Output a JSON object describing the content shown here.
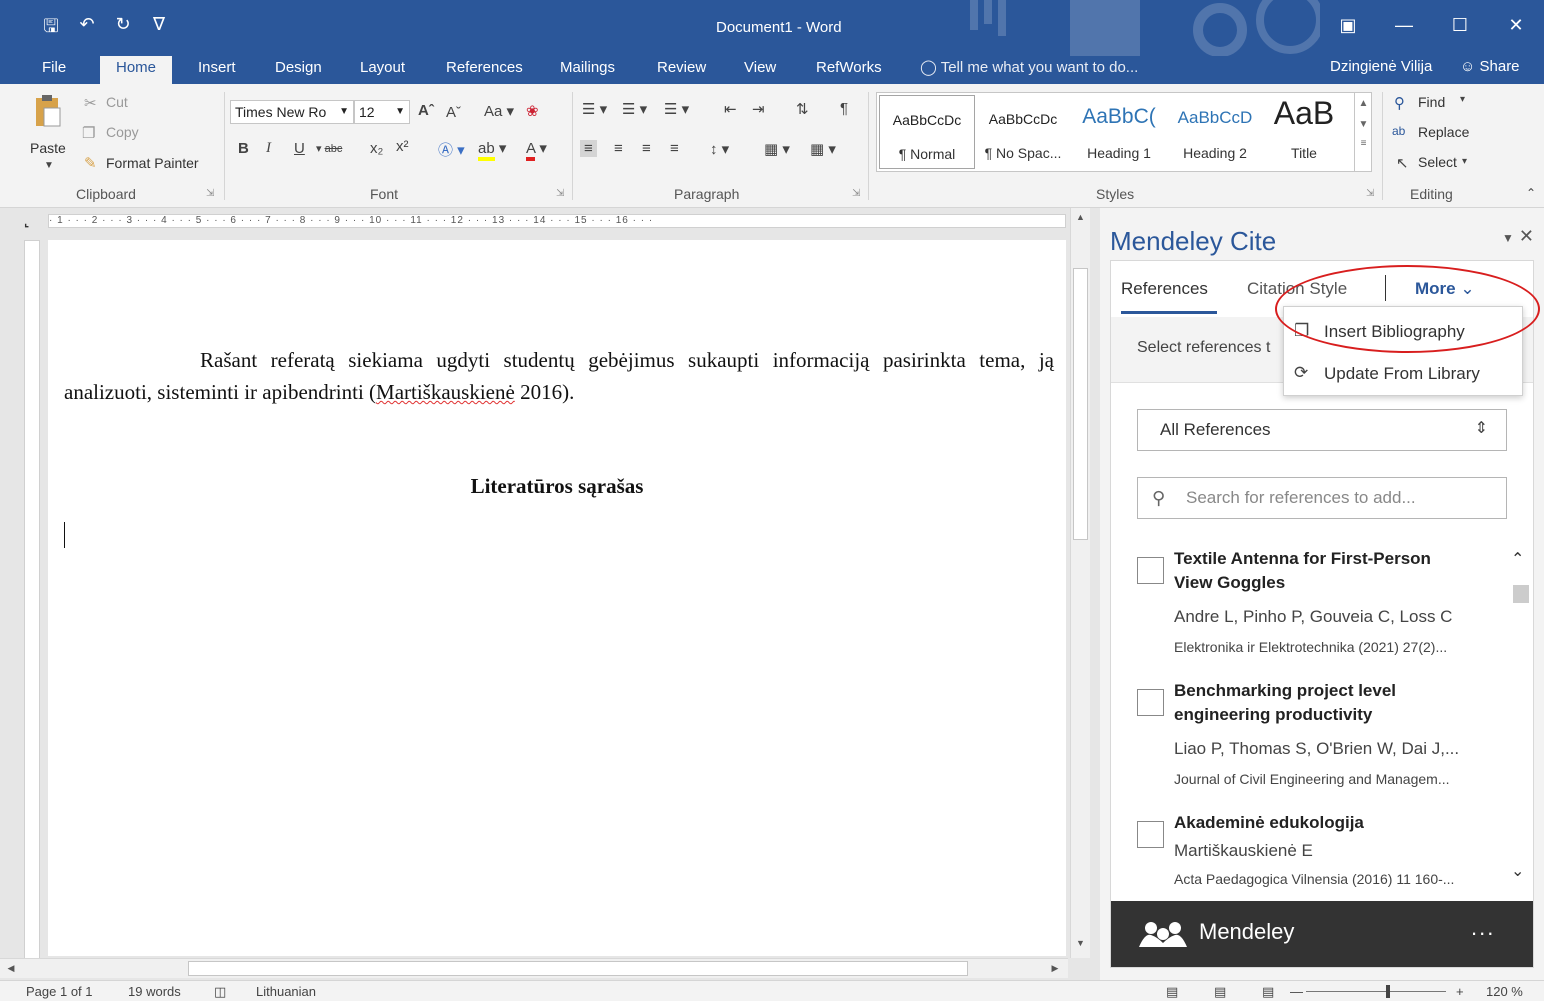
{
  "window": {
    "title": "Document1 - Word",
    "qat_icons": [
      "save-icon",
      "undo-icon",
      "redo-icon",
      "customize-icon"
    ]
  },
  "tabs": {
    "file": "File",
    "home": "Home",
    "insert": "Insert",
    "design": "Design",
    "layout": "Layout",
    "references": "References",
    "mailings": "Mailings",
    "review": "Review",
    "view": "View",
    "refworks": "RefWorks",
    "tell_me": "Tell me what you want to do...",
    "user": "Dzingienė Vilija",
    "share": "Share"
  },
  "ribbon": {
    "clipboard": {
      "label": "Clipboard",
      "paste": "Paste",
      "cut": "Cut",
      "copy": "Copy",
      "format_painter": "Format Painter"
    },
    "font": {
      "label": "Font",
      "font_name": "Times New Ro",
      "font_size": "12"
    },
    "paragraph": {
      "label": "Paragraph"
    },
    "styles": {
      "label": "Styles",
      "items": [
        {
          "preview": "AaBbCcDc",
          "name": "¶ Normal"
        },
        {
          "preview": "AaBbCcDc",
          "name": "¶ No Spac..."
        },
        {
          "preview": "AaBbC(",
          "name": "Heading 1"
        },
        {
          "preview": "AaBbCcD",
          "name": "Heading 2"
        },
        {
          "preview": "AaB",
          "name": "Title"
        }
      ]
    },
    "editing": {
      "label": "Editing",
      "find": "Find",
      "replace": "Replace",
      "select": "Select"
    }
  },
  "ruler": {
    "numbers": "· 1 · · · 2 · · · 3 · · · 4 · · · 5 · · · 6 · · · 7 · · · 8 · · · 9 · · · 10 · · · 11 · · · 12 · · · 13 · · · 14 · · · 15 · · · 16 · · ·"
  },
  "document": {
    "paragraph_before": "Rašant referatą siekiama ugdyti studentų gebėjimus sukaupti informaciją pasirinkta tema, ją analizuoti, sisteminti ir apibendrinti (",
    "citation_author": "Martiškauskienė",
    "paragraph_after": " 2016).",
    "heading": "Literatūros sąrašas"
  },
  "pane": {
    "title": "Mendeley Cite",
    "tabs": {
      "references": "References",
      "citation_style": "Citation Style",
      "more": "More"
    },
    "select_text": "Select references t",
    "filter": "All References",
    "search_placeholder": "Search for references to add...",
    "references": [
      {
        "title": "Textile Antenna for First-Person View Goggles",
        "authors": "Andre L, Pinho P, Gouveia C, Loss C",
        "journal": "Elektronika ir Elektrotechnika (2021) 27(2)..."
      },
      {
        "title": "Benchmarking project level engineering productivity",
        "authors": "Liao P, Thomas S, O'Brien W, Dai J,...",
        "journal": "Journal of Civil Engineering and Managem..."
      },
      {
        "title": "Akademinė edukologija",
        "authors": "Martiškauskienė E",
        "journal": "Acta Paedagogica Vilnensia (2016) 11 160-..."
      }
    ],
    "footer_brand": "Mendeley",
    "footer_more": "..."
  },
  "more_menu": {
    "insert_bibliography": "Insert Bibliography",
    "update_from_library": "Update From Library"
  },
  "statusbar": {
    "page": "Page 1 of 1",
    "words": "19 words",
    "language": "Lithuanian",
    "zoom": "120 %"
  },
  "colors": {
    "word_blue": "#2b579a",
    "annotation_red": "#d81e1e",
    "mendeley_footer": "#333333"
  }
}
